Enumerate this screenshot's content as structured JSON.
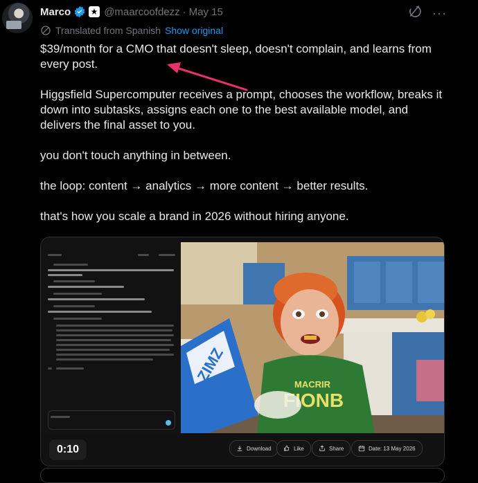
{
  "header": {
    "display_name": "Marco",
    "handle": "@maarcoofdezz",
    "separator": "·",
    "date": "May 15",
    "more_label": "···"
  },
  "translation": {
    "label": "Translated from Spanish",
    "show_original": "Show original"
  },
  "tweet": {
    "paragraphs": [
      "$39/month for a CMO that doesn't sleep, doesn't complain, and learns from every post.",
      "Higgsfield Supercomputer receives a prompt, chooses the workflow, breaks it down into subtasks, assigns each one to the best available model, and delivers the final asset to you.",
      "you don't touch anything in between.",
      "the loop: content → analytics → more content → better results.",
      "that's how you scale a brand in 2026 without hiring anyone."
    ]
  },
  "media": {
    "time": "0:10",
    "actions": {
      "download": "Download",
      "like": "Like",
      "share": "Share",
      "date": "Date: 13 May 2026"
    },
    "shirt_text": {
      "line1": "MACRIR",
      "line2": "FIONB"
    },
    "box_text": "ZIMZ"
  },
  "colors": {
    "accent": "#1d9bf0",
    "arrow": "#e8306b",
    "hair": "#d6531f",
    "shirt": "#2e7a34",
    "box": "#2a6fc9"
  }
}
